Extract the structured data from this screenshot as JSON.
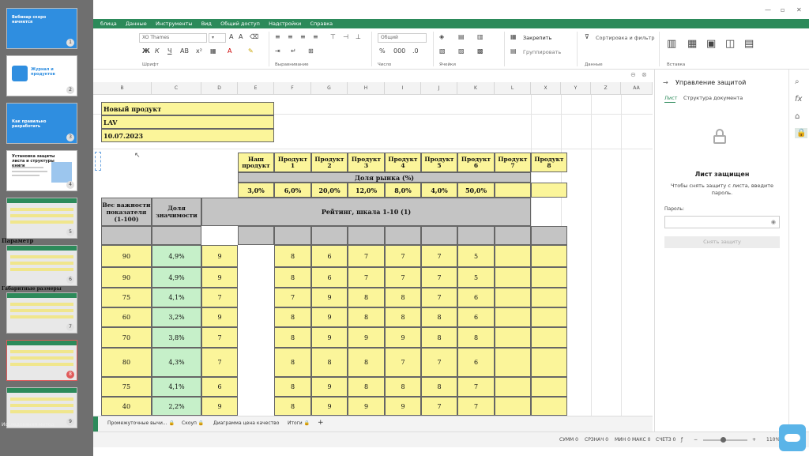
{
  "slides": {
    "thumbs": [
      {
        "title": "Вебинар скоро начнется",
        "num": "1"
      },
      {
        "title": "Журнал и продуктов",
        "num": "2"
      },
      {
        "title": "Как правильно разработать",
        "num": "3"
      },
      {
        "title": "Установка защиты листа и структуры книги",
        "num": "4"
      },
      {
        "title": "",
        "num": "5"
      },
      {
        "title": "",
        "num": "6"
      },
      {
        "title": "",
        "num": "7"
      },
      {
        "title": "",
        "num": "8"
      },
      {
        "title": "",
        "num": "9"
      }
    ],
    "bleed_texts": [
      "Параметр",
      "Габаритные размеры",
      "Исследования метод"
    ]
  },
  "menu": [
    "блица",
    "Данные",
    "Инструменты",
    "Вид",
    "Общий доступ",
    "Надстройки",
    "Справка"
  ],
  "ribbon": {
    "font_name": "XO Thames",
    "number_format": "Общий",
    "freeze_label": "Закрепить",
    "group_label": "Группировать",
    "sort_label": "Сортировка и фильтр",
    "groups": {
      "font": "Шрифт",
      "align": "Выравнивание",
      "number": "Число",
      "cells": "Ячейки",
      "data": "Данные",
      "insert": "Вставка"
    }
  },
  "columns": [
    "B",
    "C",
    "D",
    "E",
    "F",
    "G",
    "H",
    "I",
    "J",
    "K",
    "L",
    "X",
    "Y",
    "Z",
    "AA"
  ],
  "sheet": {
    "product_title": "Новый продукт",
    "author": "LAV",
    "date": "10.07.2023",
    "header_products": [
      "Наш продукт",
      "Продукт 1",
      "Продукт 2",
      "Продукт 3",
      "Продукт 4",
      "Продукт 5",
      "Продукт 6",
      "Продукт 7",
      "Продукт 8"
    ],
    "market_share_label": "Доля рынка (%)",
    "market_shares": [
      "3,0%",
      "6,0%",
      "20,0%",
      "12,0%",
      "8,0%",
      "4,0%",
      "50,0%",
      "",
      ""
    ],
    "weight_header": "Вес важности показателя (1-100)",
    "share_header": "Доля значимости",
    "rating_header": "Рейтинг, шкала 1-10 (1)",
    "rows": [
      {
        "weight": "90",
        "share": "4,9%",
        "ratings": [
          "9",
          "8",
          "6",
          "7",
          "7",
          "7",
          "5",
          "",
          ""
        ]
      },
      {
        "weight": "90",
        "share": "4,9%",
        "ratings": [
          "9",
          "8",
          "6",
          "7",
          "7",
          "7",
          "5",
          "",
          ""
        ]
      },
      {
        "weight": "75",
        "share": "4,1%",
        "ratings": [
          "7",
          "7",
          "9",
          "8",
          "8",
          "7",
          "6",
          "",
          ""
        ]
      },
      {
        "weight": "60",
        "share": "3,2%",
        "ratings": [
          "9",
          "8",
          "9",
          "8",
          "8",
          "8",
          "6",
          "",
          ""
        ]
      },
      {
        "weight": "70",
        "share": "3,8%",
        "ratings": [
          "7",
          "8",
          "9",
          "9",
          "9",
          "8",
          "8",
          "",
          ""
        ]
      },
      {
        "weight": "80",
        "share": "4,3%",
        "ratings": [
          "7",
          "8",
          "8",
          "8",
          "7",
          "7",
          "6",
          "",
          ""
        ]
      },
      {
        "weight": "75",
        "share": "4,1%",
        "ratings": [
          "6",
          "8",
          "9",
          "8",
          "8",
          "8",
          "7",
          "",
          ""
        ]
      },
      {
        "weight": "40",
        "share": "2,2%",
        "ratings": [
          "9",
          "8",
          "9",
          "9",
          "9",
          "7",
          "7",
          "",
          ""
        ]
      }
    ]
  },
  "tabs": [
    "Промежуточные вычи...",
    "Скоуп",
    "Диаграмма цена качество",
    "Итоги"
  ],
  "status": {
    "sum": "СУММ 0",
    "avg": "СРЗНАЧ 0",
    "min": "МИН 0",
    "max": "МАКС 0",
    "count": "СЧЕТЗ 0",
    "zoom": "110%"
  },
  "panel": {
    "title": "Управление защитой",
    "tab_sheet": "Лист",
    "tab_structure": "Структура документа",
    "protected_title": "Лист защищен",
    "protected_desc": "Чтобы снять защиту с листа, введите пароль.",
    "password_label": "Пароль:",
    "unprotect_button": "Снять защиту"
  },
  "colors": {
    "accent": "#2c8a5a",
    "yellow": "#fbf59a",
    "green": "#c6f0c9",
    "gray": "#c4c4c4"
  }
}
